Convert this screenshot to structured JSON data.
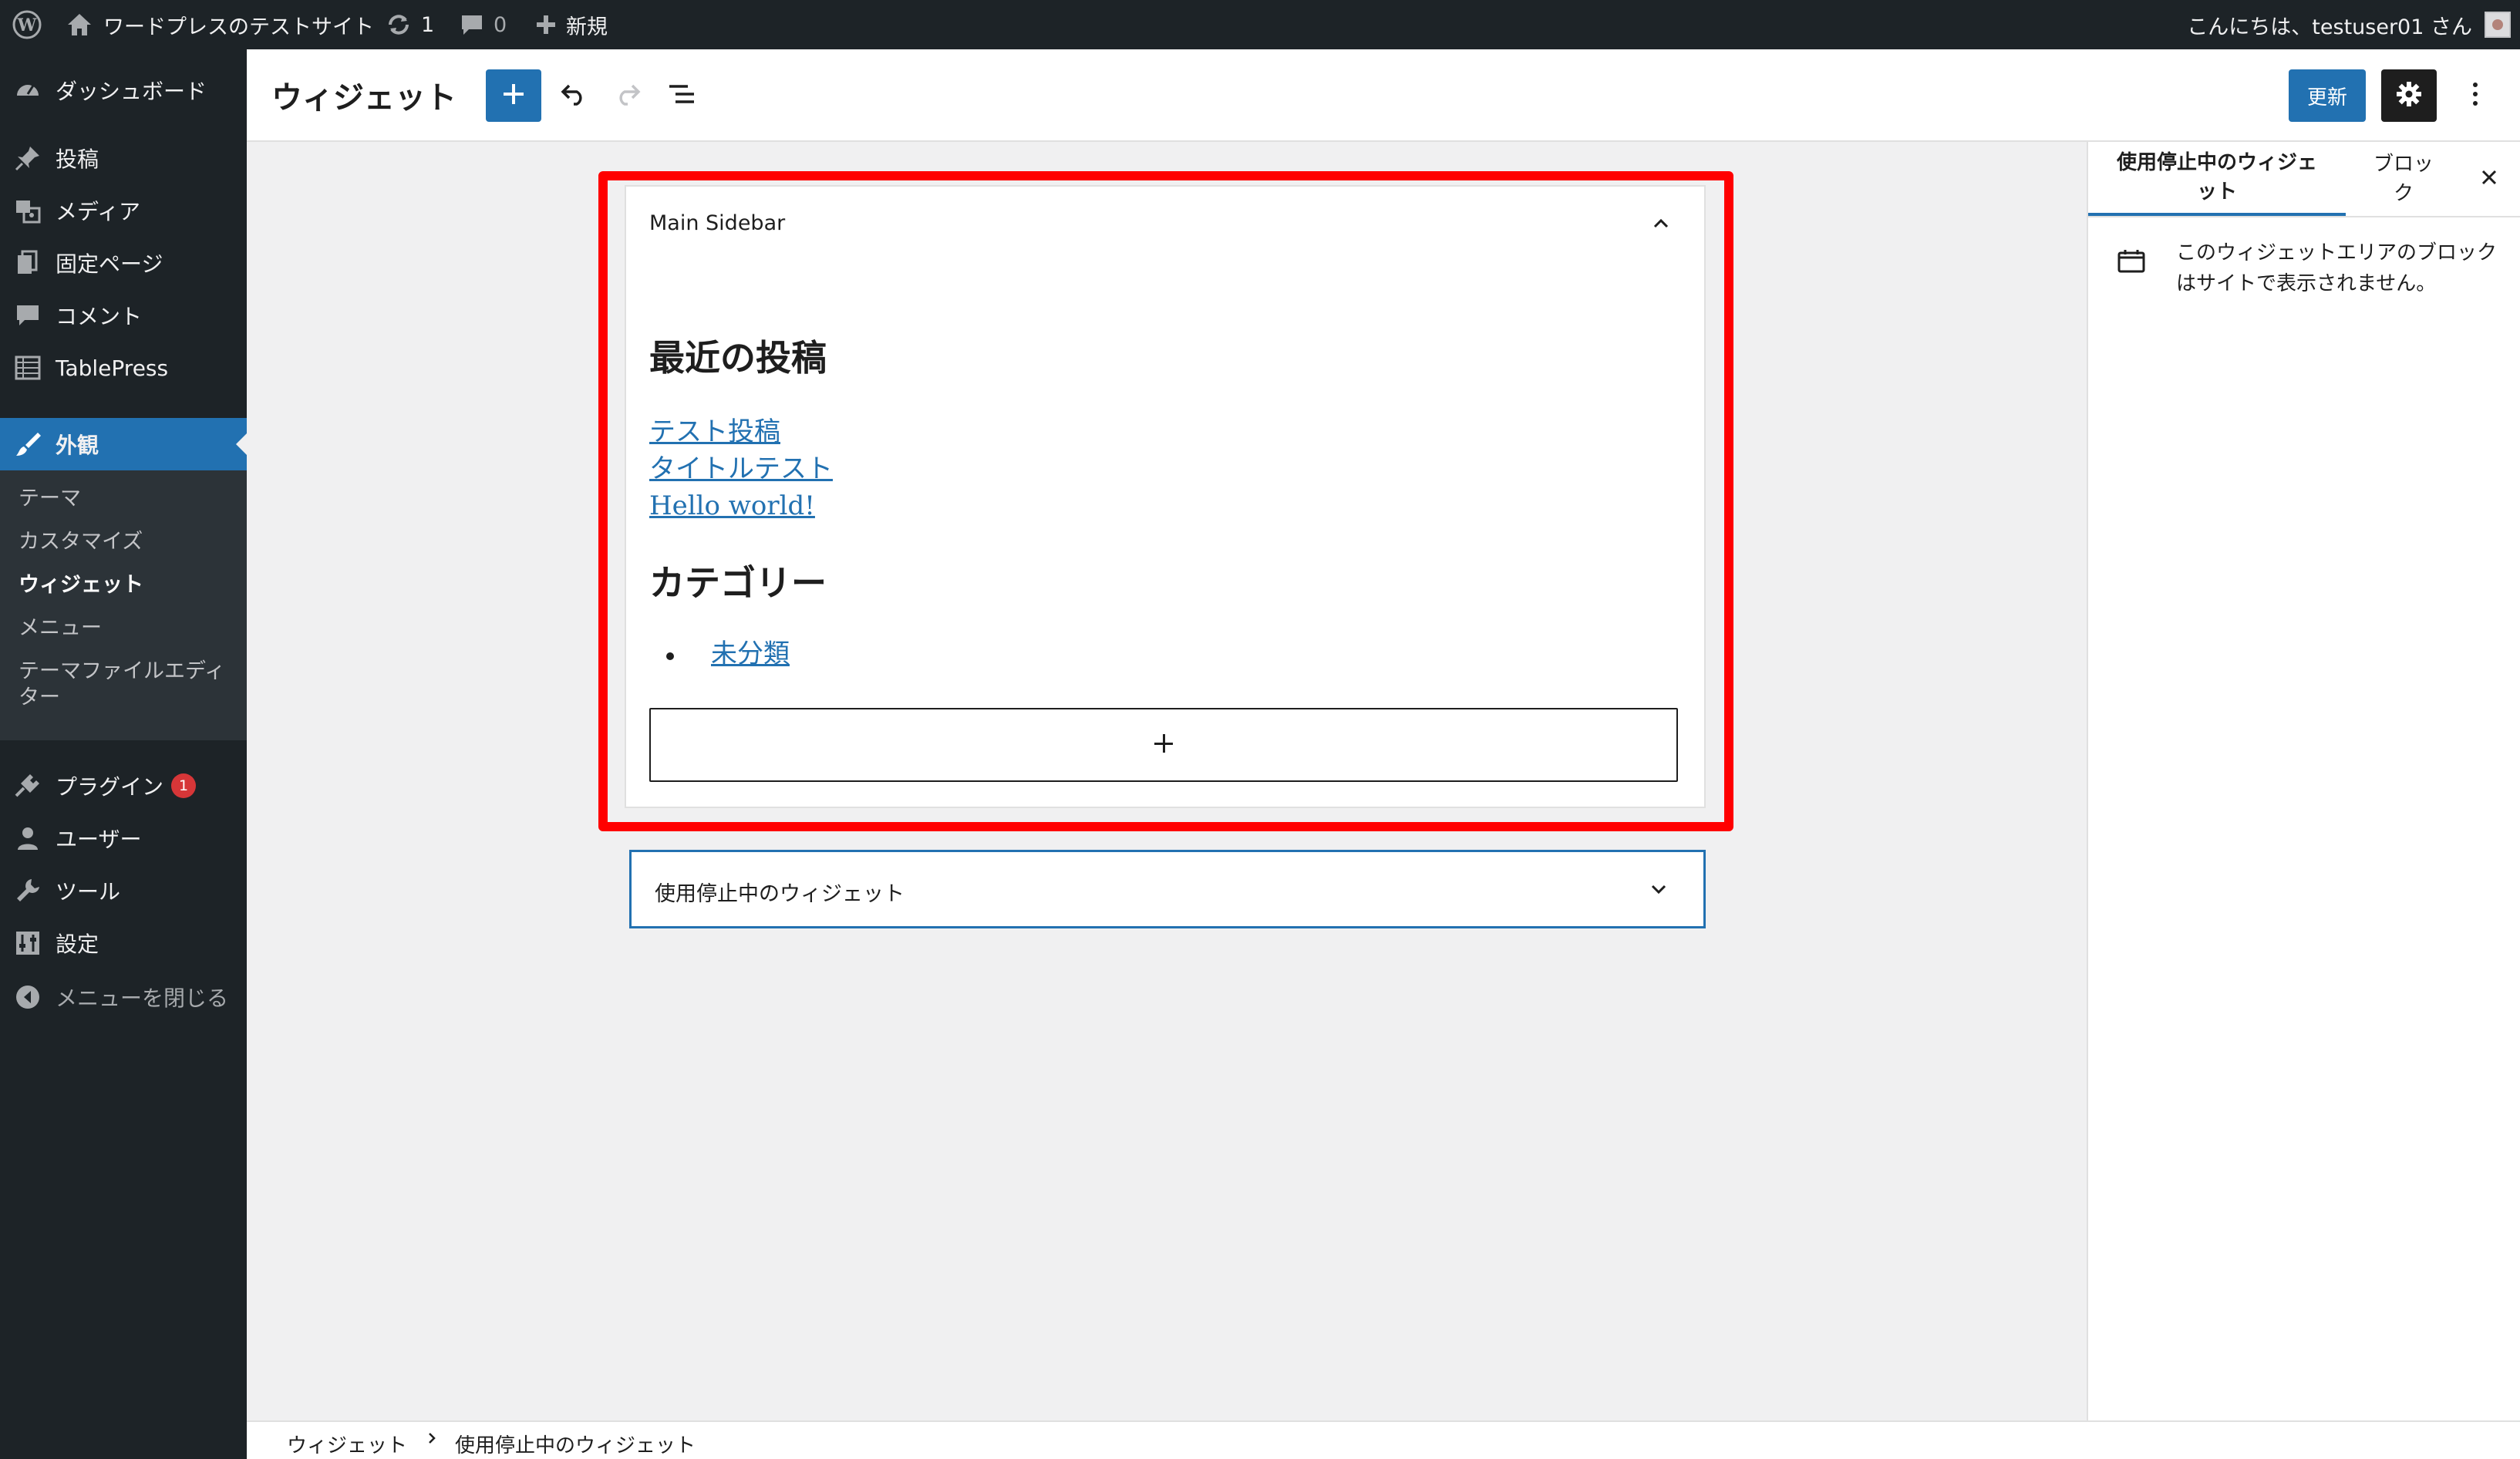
{
  "admin_bar": {
    "site_name": "ワードプレスのテストサイト",
    "updates_count": "1",
    "comments_count": "0",
    "new_label": "新規",
    "greeting": "こんにちは、testuser01 さん"
  },
  "sidebar": {
    "items": [
      {
        "label": "ダッシュボード",
        "icon": "dashboard-icon"
      },
      {
        "label": "投稿",
        "icon": "pin-icon"
      },
      {
        "label": "メディア",
        "icon": "media-icon"
      },
      {
        "label": "固定ページ",
        "icon": "page-icon"
      },
      {
        "label": "コメント",
        "icon": "comment-icon"
      },
      {
        "label": "TablePress",
        "icon": "table-icon"
      },
      {
        "label": "外観",
        "icon": "brush-icon"
      },
      {
        "label": "プラグイン",
        "icon": "plugin-icon",
        "badge": "1"
      },
      {
        "label": "ユーザー",
        "icon": "user-icon"
      },
      {
        "label": "ツール",
        "icon": "wrench-icon"
      },
      {
        "label": "設定",
        "icon": "settings-sliders-icon"
      },
      {
        "label": "メニューを閉じる",
        "icon": "collapse-arrow-icon"
      }
    ],
    "submenu": {
      "theme": "テーマ",
      "customize": "カスタマイズ",
      "widgets": "ウィジェット",
      "menus": "メニュー",
      "theme_editor_1": "テーマファイルエディ",
      "theme_editor_2": "ター"
    }
  },
  "editor": {
    "title": "ウィジェット",
    "update_label": "更新"
  },
  "main_sidebar": {
    "title": "Main Sidebar",
    "recent_posts_heading": "最近の投稿",
    "posts": [
      "テスト投稿",
      "タイトルテスト",
      "Hello world!"
    ],
    "categories_heading": "カテゴリー",
    "categories": [
      "未分類"
    ]
  },
  "inactive_widgets": {
    "title": "使用停止中のウィジェット"
  },
  "settings_panel": {
    "tab_inactive_1": "使用停止中のウィジェ",
    "tab_inactive_2": "ット",
    "tab_block_1": "ブロッ",
    "tab_block_2": "ク",
    "description_1": "このウィジェットエリアのブロック",
    "description_2": "はサイトで表示されません。"
  },
  "breadcrumb": {
    "root": "ウィジェット",
    "current": "使用停止中のウィジェット"
  },
  "colors": {
    "admin_dark": "#1d2327",
    "accent_blue": "#2271b1",
    "highlight_red": "#ff0000",
    "badge_red": "#d63638"
  }
}
